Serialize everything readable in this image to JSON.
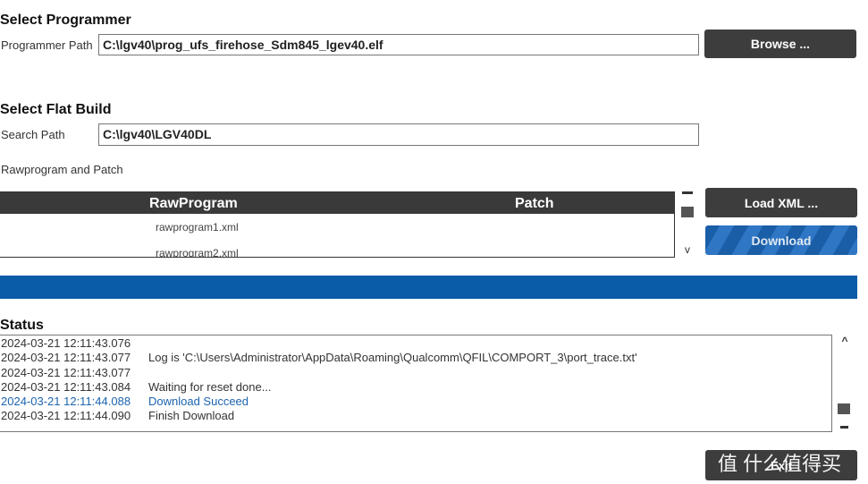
{
  "programmer": {
    "title": "Select Programmer",
    "path_label": "Programmer Path",
    "path_value": "C:\\lgv40\\prog_ufs_firehose_Sdm845_lgev40.elf",
    "browse_label": "Browse ..."
  },
  "flat_build": {
    "title": "Select Flat Build",
    "search_label": "Search Path",
    "search_value": "C:\\lgv40\\LGV40DL",
    "raw_patch_label": "Rawprogram and Patch",
    "columns": [
      "RawProgram",
      "Patch"
    ],
    "rows": [
      {
        "rawprogram": "rawprogram1.xml",
        "patch": ""
      },
      {
        "rawprogram": "rawprogram2.xml",
        "patch": ""
      }
    ],
    "load_xml_label": "Load XML ...",
    "download_label": "Download"
  },
  "progress": {
    "percent": 100,
    "color": "#0a5ca8"
  },
  "status": {
    "title": "Status",
    "log": [
      {
        "time": "2024-03-21 12:11:43.076",
        "msg": ""
      },
      {
        "time": "2024-03-21 12:11:43.077",
        "msg": "Log is 'C:\\Users\\Administrator\\AppData\\Roaming\\Qualcomm\\QFIL\\COMPORT_3\\port_trace.txt'"
      },
      {
        "time": "2024-03-21 12:11:43.077",
        "msg": ""
      },
      {
        "time": "2024-03-21 12:11:43.084",
        "msg": "Waiting for reset done..."
      },
      {
        "time": "2024-03-21 12:11:44.088",
        "msg": "Download Succeed",
        "highlight": true
      },
      {
        "time": "2024-03-21 12:11:44.090",
        "msg": "Finish Download"
      }
    ]
  },
  "exit_label": "Exit",
  "watermark": "值 什么值得买"
}
